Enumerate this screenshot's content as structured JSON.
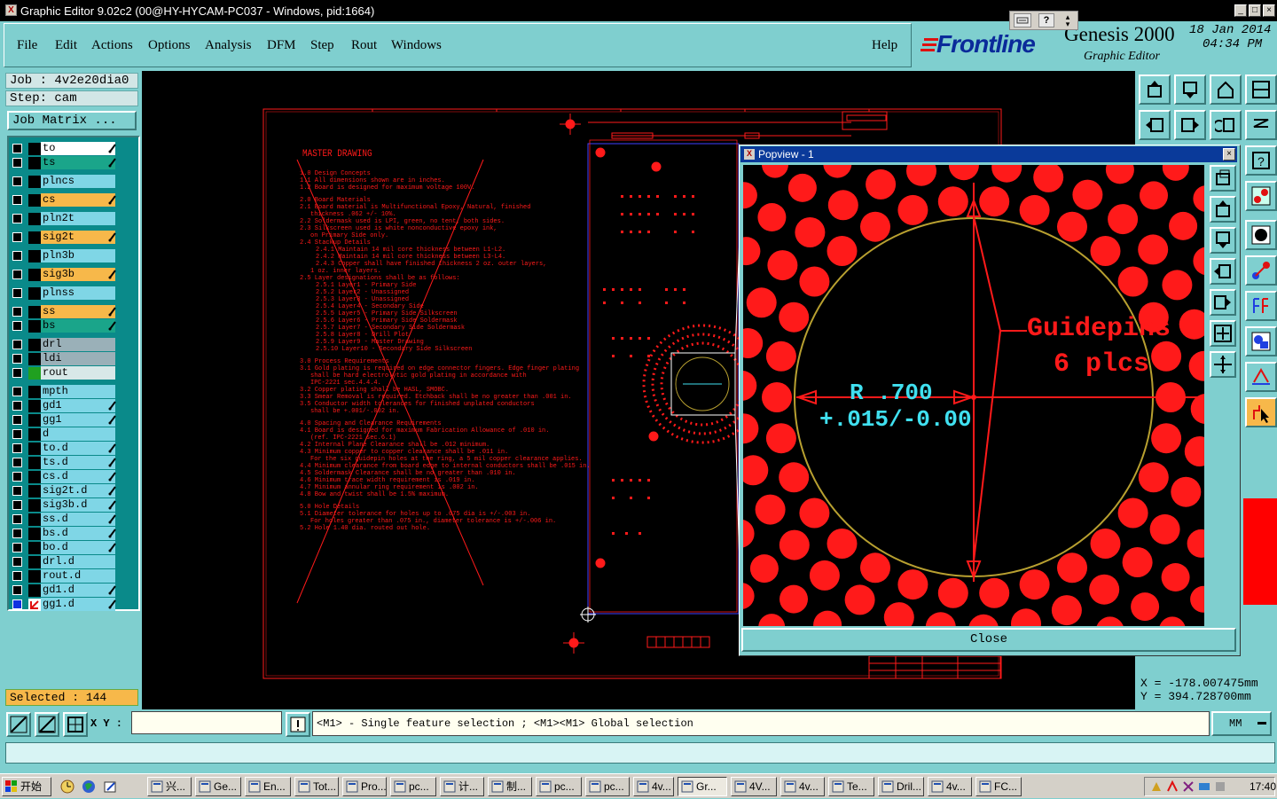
{
  "window": {
    "title": "Graphic Editor 9.02c2 (00@HY-HYCAM-PC037 - Windows, pid:1664)",
    "controls": [
      "_",
      "□",
      "×"
    ]
  },
  "menu": {
    "items": [
      "File",
      "Edit",
      "Actions",
      "Options",
      "Analysis",
      "DFM",
      "Step",
      "Rout",
      "Windows"
    ],
    "help": "Help"
  },
  "brand": {
    "logo": "Frontline",
    "product": "Genesis 2000",
    "subtitle": "Graphic Editor",
    "date": "18 Jan 2014",
    "time": "04:34 PM"
  },
  "job": {
    "job_label": "Job : 4v2e20dia0",
    "step_label": "Step: cam",
    "matrix_button": "Job Matrix ..."
  },
  "layers": [
    {
      "name": "to",
      "color": "#ffffff",
      "edit": true
    },
    {
      "name": "ts",
      "color": "#1aa58a",
      "edit": true
    },
    {
      "name": "plncs",
      "color": "#7fd6e6",
      "edit": false
    },
    {
      "name": "cs",
      "color": "#f7b84a",
      "edit": true
    },
    {
      "name": "pln2t",
      "color": "#7fd6e6",
      "edit": false
    },
    {
      "name": "sig2t",
      "color": "#f7b84a",
      "edit": true
    },
    {
      "name": "pln3b",
      "color": "#7fd6e6",
      "edit": false
    },
    {
      "name": "sig3b",
      "color": "#f7b84a",
      "edit": true
    },
    {
      "name": "plnss",
      "color": "#7fd6e6",
      "edit": false
    },
    {
      "name": "ss",
      "color": "#f7b84a",
      "edit": true
    },
    {
      "name": "bs",
      "color": "#1aa58a",
      "edit": true
    },
    {
      "name": "drl",
      "color": "#9ab0b8",
      "edit": false
    },
    {
      "name": "ldi",
      "color": "#9ab0b8",
      "edit": false
    },
    {
      "name": "rout",
      "color": "#d8e8e8",
      "edit": false
    },
    {
      "name": "mpth",
      "color": "#7fd6e6",
      "edit": false
    },
    {
      "name": "gd1",
      "color": "#7fd6e6",
      "edit": true
    },
    {
      "name": "gg1",
      "color": "#7fd6e6",
      "edit": true
    },
    {
      "name": "d",
      "color": "#7fd6e6",
      "edit": false
    },
    {
      "name": "to.d",
      "color": "#7fd6e6",
      "edit": true
    },
    {
      "name": "ts.d",
      "color": "#7fd6e6",
      "edit": true
    },
    {
      "name": "cs.d",
      "color": "#7fd6e6",
      "edit": true
    },
    {
      "name": "sig2t.d",
      "color": "#7fd6e6",
      "edit": true
    },
    {
      "name": "sig3b.d",
      "color": "#7fd6e6",
      "edit": true
    },
    {
      "name": "ss.d",
      "color": "#7fd6e6",
      "edit": true
    },
    {
      "name": "bs.d",
      "color": "#7fd6e6",
      "edit": true
    },
    {
      "name": "bo.d",
      "color": "#7fd6e6",
      "edit": true
    },
    {
      "name": "drl.d",
      "color": "#7fd6e6",
      "edit": false
    },
    {
      "name": "rout.d",
      "color": "#7fd6e6",
      "edit": false
    },
    {
      "name": "gd1.d",
      "color": "#7fd6e6",
      "edit": true
    },
    {
      "name": "gg1.d",
      "color": "#7fd6e6",
      "edit": true
    }
  ],
  "selected": "Selected : 144",
  "drawing": {
    "title": "MASTER DRAWING",
    "notes": [
      "1.0 Design Concepts",
      "1.1 All dimensions shown are in inches.",
      "1.2 Board is designed for maximum voltage 100V.",
      "2.0 Board Materials",
      "2.1 Board material is Multifunctional Epoxy, Natural, finished",
      "thickness .062 +/- 10%.",
      "2.2 Soldermask used is LPI, green, no tent, both sides.",
      "2.3 Silkscreen used is white nonconductive epoxy ink,",
      "on Primary Side only.",
      "2.4 Stackup Details",
      "2.4.1 Maintain 14 mil core thickness between L1-L2.",
      "2.4.2 Maintain 14 mil core thickness between L3-L4.",
      "2.4.3 Copper shall have finished thickness 2 oz. outer layers,",
      "1 oz. inner layers.",
      "2.5 Layer designations shall be as follows:",
      "2.5.1 Layer1 - Primary Side",
      "2.5.2 Layer2 - Unassigned",
      "2.5.3 Layer3 - Unassigned",
      "2.5.4 Layer4 - Secondary Side",
      "2.5.5 Layer5 - Primary Side Silkscreen",
      "2.5.6 Layer6 - Primary Side Soldermask",
      "2.5.7 Layer7 - Secondary Side Soldermask",
      "2.5.8 Layer8 - Drill Plot",
      "2.5.9 Layer9 - Master Drawing",
      "2.5.10 Layer10 - Secondary Side Silkscreen",
      "3.0 Process Requirements",
      "3.1 Gold plating is required on edge connector fingers. Edge finger plating",
      "shall be hard electrolytic gold plating in accordance with",
      "IPC-2221 sec.4.4.4.",
      "3.2 Copper plating shall be HASL, SMOBC.",
      "3.3 Smear Removal is required. Etchback shall be no greater than .001 in.",
      "3.5 Conductor width tolerances for finished unplated conductors",
      "shall be +.001/-.002 in.",
      "4.0 Spacing and Clearance Requirements",
      "4.1 Board is designed for maximum Fabrication Allowance of .010 in.",
      "(ref. IPC-2221 sec.6.1)",
      "4.2 Internal Plane Clearance shall be .012 minimum.",
      "4.3 Minimum copper to copper clearance shall be .011 in.",
      "For the six guidepin holes at the ring, a 5 mil copper clearance applies.",
      "4.4 Minimum clearance from board edge to internal conductors shall be .015 in.",
      "4.5 Soldermask Clearance shall be no greater than .010 in.",
      "4.6 Minimum trace width requirement is .019 in.",
      "4.7 Minimum annular ring requirement is .002 in.",
      "4.8 Bow and twist shall be 1.5% maximum.",
      "5.0 Hole Details",
      "5.1 Diameter tolerance for holes up to .075 dia is +/-.003 in.",
      "For holes greater than .075 in., diameter tolerance is +/-.006 in.",
      "5.2 Hole 1.40 dia. routed out hole."
    ]
  },
  "popview": {
    "title": "Popview - 1",
    "annotation_1": "Guidepins",
    "annotation_2": "6 plcs",
    "dimension": "R .700",
    "tolerance": "+.015/-0.00",
    "close": "Close"
  },
  "coords": {
    "x_label": "X = -178.007475mm",
    "y_label": "Y = 394.728700mm"
  },
  "bottom": {
    "xy_label": "X Y :",
    "xy_value": "",
    "message": "<M1> - Single feature selection ; <M1><M1> Global selection",
    "units": "MM"
  },
  "taskbar": {
    "start": "开始",
    "tasks": [
      "兴...",
      "Ge...",
      "En...",
      "Tot...",
      "Pro...",
      "pc...",
      "计...",
      "制...",
      "pc...",
      "pc...",
      "4v...",
      "Gr...",
      "4V...",
      "4v...",
      "Te...",
      "Dril...",
      "4v...",
      "FC..."
    ],
    "clock": "17:40"
  },
  "colors": {
    "accent_teal": "#7fcfcf",
    "drawing_red": "#ff1a1a",
    "ring_gold": "#b8a030",
    "dim_cyan": "#40e0f0",
    "popview_title": "#0a3a9a",
    "selected_orange": "#f7b84a"
  }
}
